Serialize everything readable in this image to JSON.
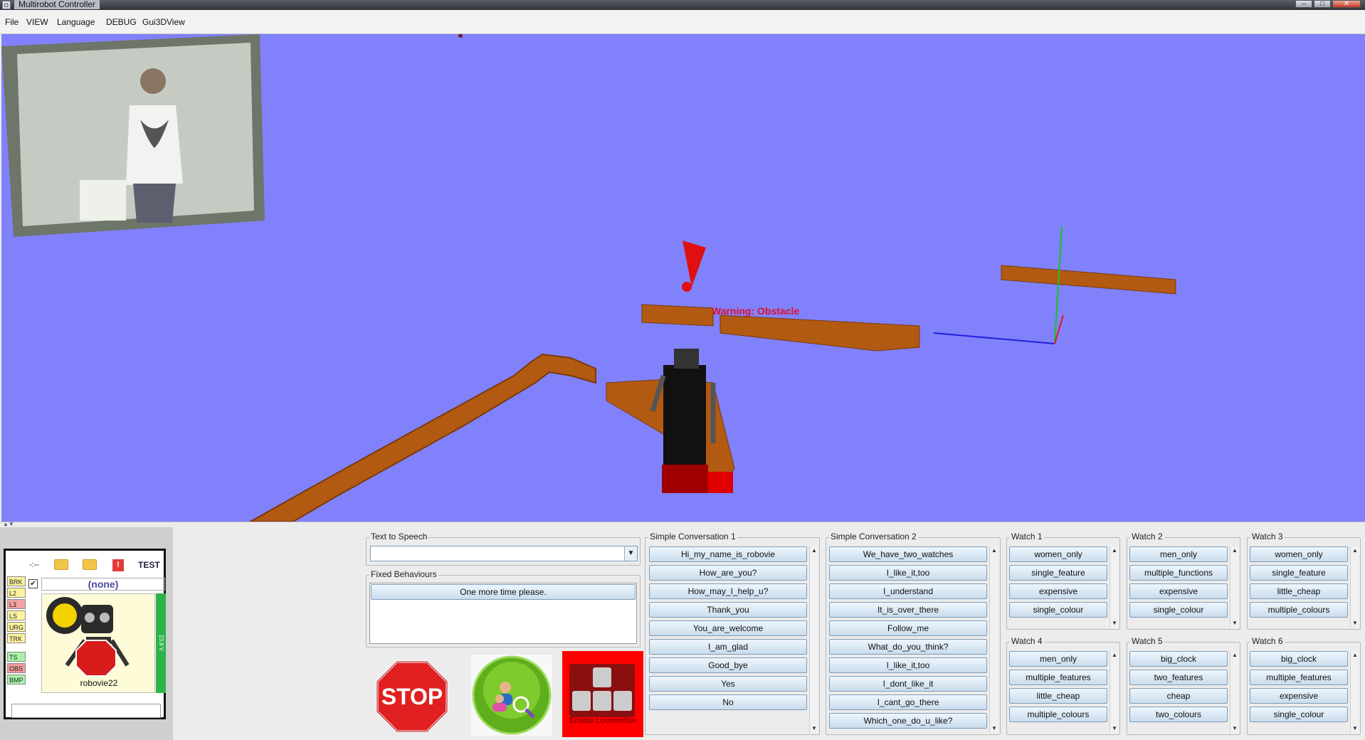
{
  "window": {
    "title": "Multirobot Controller"
  },
  "menu": [
    "File",
    "VIEW",
    "Language",
    "DEBUG",
    "Gui3DView"
  ],
  "view3d": {
    "warning": "Warning: Obstacle"
  },
  "robot_panel": {
    "toolbar_status": "-:--",
    "test_label": "TEST",
    "sensors": [
      "BRK",
      "L2",
      "L3",
      "LS",
      "URG",
      "TRK",
      "TS",
      "OBS",
      "BMP"
    ],
    "selected": "(none)",
    "robot_name": "robovie22",
    "battery": "23.8 V",
    "stop_label": "STOP"
  },
  "text_to_speech": {
    "title": "Text to Speech",
    "value": ""
  },
  "fixed_behaviours": {
    "title": "Fixed Behaviours",
    "items": [
      "One more time please."
    ]
  },
  "controls": {
    "stop_label": "STOP",
    "locomotion_label": "Enable Locomotion"
  },
  "simple_conversation_1": {
    "title": "Simple Conversation 1",
    "items": [
      "Hi_my_name_is_robovie",
      "How_are_you?",
      "How_may_I_help_u?",
      "Thank_you",
      "You_are_welcome",
      "I_am_glad",
      "Good_bye",
      "Yes",
      "No"
    ]
  },
  "simple_conversation_2": {
    "title": "Simple Conversation 2",
    "items": [
      "We_have_two_watches",
      "I_like_it,too",
      "I_understand",
      "It_is_over_there",
      "Follow_me",
      "What_do_you_think?",
      "I_like_it,too",
      "I_dont_like_it",
      "I_cant_go_there",
      "Which_one_do_u_like?"
    ]
  },
  "watches": [
    {
      "title": "Watch 1",
      "items": [
        "women_only",
        "single_feature",
        "expensive",
        "single_colour"
      ]
    },
    {
      "title": "Watch 2",
      "items": [
        "men_only",
        "multiple_functions",
        "expensive",
        "single_colour"
      ]
    },
    {
      "title": "Watch 3",
      "items": [
        "women_only",
        "single_feature",
        "little_cheap",
        "multiple_colours"
      ]
    },
    {
      "title": "Watch 4",
      "items": [
        "men_only",
        "multiple_features",
        "little_cheap",
        "multiple_colours"
      ]
    },
    {
      "title": "Watch 5",
      "items": [
        "big_clock",
        "two_features",
        "cheap",
        "two_colours"
      ]
    },
    {
      "title": "Watch 6",
      "items": [
        "big_clock",
        "multiple_features",
        "expensive",
        "single_colour"
      ]
    }
  ]
}
